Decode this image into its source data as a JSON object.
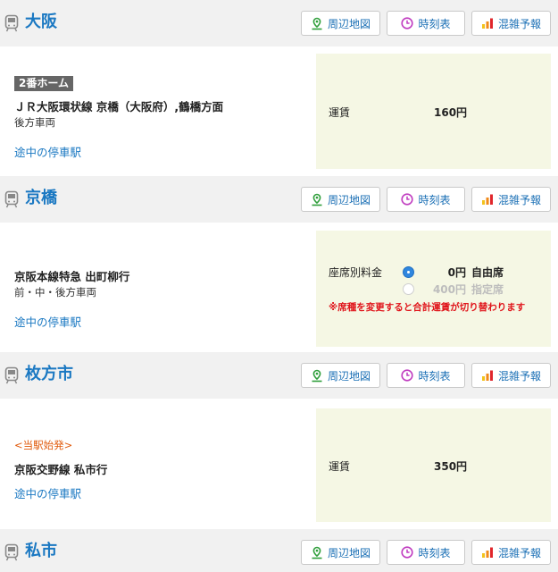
{
  "buttons": {
    "map_label": "周辺地図",
    "timetable_label": "時刻表",
    "crowd_label": "混雑予報"
  },
  "stations": [
    {
      "name": "大阪"
    },
    {
      "name": "京橋"
    },
    {
      "name": "枚方市"
    },
    {
      "name": "私市"
    }
  ],
  "segments": [
    {
      "platform": "2番ホーム",
      "line": "ＪＲ大阪環状線 京橋（大阪府）,鶴橋方面",
      "car_position": "後方車両",
      "stops_link": "途中の停車駅",
      "fare_label": "運賃",
      "fare_value": "160円"
    },
    {
      "line": "京阪本線特急 出町柳行",
      "car_position": "前・中・後方車両",
      "stops_link": "途中の停車駅",
      "seat_fare_label": "座席別料金",
      "seat_options": [
        {
          "price": "0円",
          "type": "自由席",
          "selected": true
        },
        {
          "price": "400円",
          "type": "指定席",
          "selected": false
        }
      ],
      "warning": "※席種を変更すると合計運賃が切り替わります"
    },
    {
      "origin_note": "<当駅始発>",
      "line": "京阪交野線 私市行",
      "stops_link": "途中の停車駅",
      "fare_label": "運賃",
      "fare_value": "350円"
    }
  ],
  "colors": {
    "station_name": "#1a78c2",
    "link": "#1a78c2",
    "fare_bg": "#f5f7e4",
    "warning": "#e0151b",
    "origin_note": "#e05a0c",
    "map_icon": "#2e9e3a",
    "clock_icon": "#c03cc0"
  }
}
